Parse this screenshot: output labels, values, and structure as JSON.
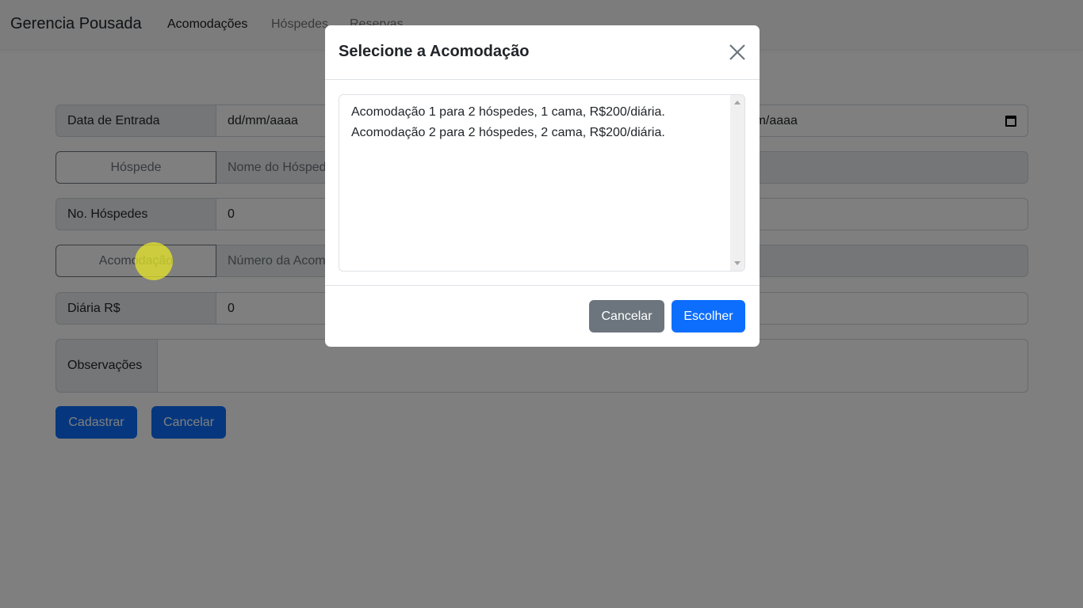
{
  "navbar": {
    "brand": "Gerencia Pousada",
    "links": [
      "Acomodações",
      "Hóspedes",
      "Reservas"
    ]
  },
  "form": {
    "entry_date_label": "Data de Entrada",
    "entry_date_placeholder": "dd/mm/aaaa",
    "exit_date_placeholder": "dd/mm/aaaa",
    "guest_button": "Hóspede",
    "guest_placeholder": "Nome do Hóspede",
    "guest_count_label": "No. Hóspedes",
    "guest_count_value": "0",
    "room_button": "Acomodação",
    "room_placeholder": "Número da Acomodação",
    "daily_label": "Diária R$",
    "daily_value": "0",
    "notes_label": "Observações",
    "submit": "Cadastrar",
    "cancel": "Cancelar"
  },
  "modal": {
    "title": "Selecione a Acomodação",
    "options": [
      "Acomodação 1 para 2 hóspedes, 1 cama, R$200/diária.",
      "Acomodação 2 para 2 hóspedes, 2 cama, R$200/diária."
    ],
    "cancel": "Cancelar",
    "choose": "Escolher"
  },
  "colors": {
    "primary": "#0d6efd",
    "secondary": "#6c757d"
  }
}
